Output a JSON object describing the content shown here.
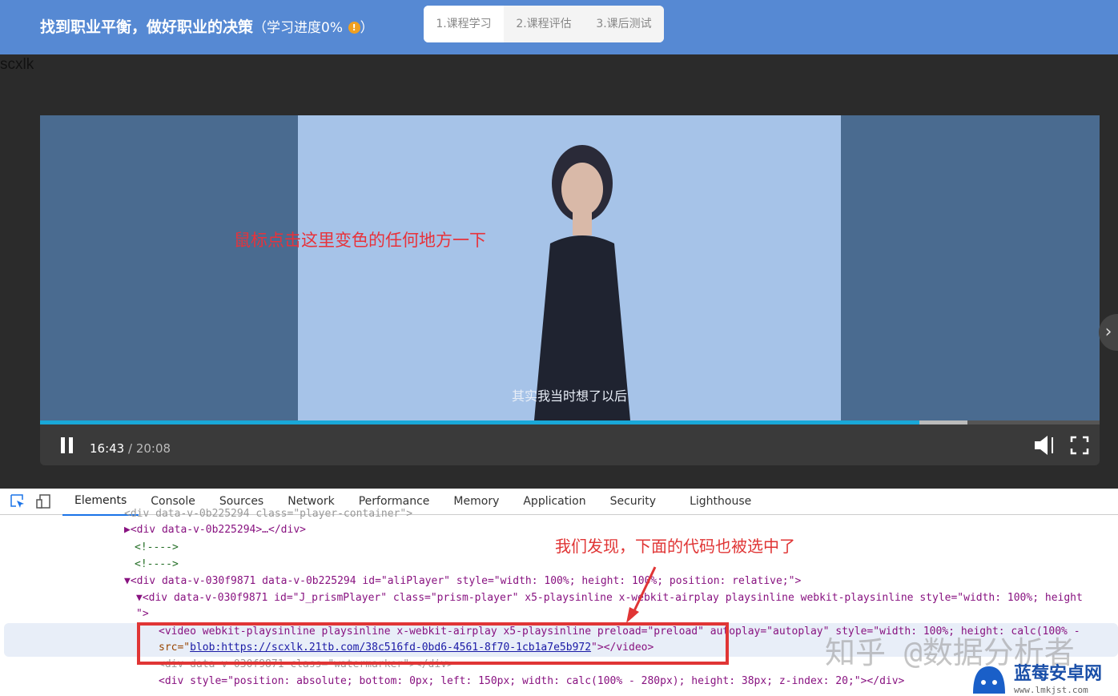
{
  "header": {
    "title": "找到职业平衡，做好职业的决策",
    "progress_note": "（学习进度0%",
    "info_icon": "!",
    "close_paren": "）",
    "steps": [
      {
        "label": "1.课程学习",
        "active": true
      },
      {
        "label": "2.课程评估"
      },
      {
        "label": "3.课后测试"
      }
    ]
  },
  "site_label": "scxlk",
  "player": {
    "hint": "鼠标点击这里变色的任何地方一下",
    "subtitle": "其实我当时想了以后",
    "current_time": "16:43",
    "duration": " / 20:08",
    "played_fraction": 0.83,
    "buffered_fraction": 0.875,
    "state": "playing"
  },
  "devtools": {
    "tabs": [
      "Elements",
      "Console",
      "Sources",
      "Network",
      "Performance",
      "Memory",
      "Application",
      "Security",
      "Lighthouse"
    ],
    "active_tab": "Elements",
    "annotation": "我们发现，下面的代码也被选中了",
    "lines": [
      "<div data-v-0b225294 class=\"player-container\">",
      "▶<div data-v-0b225294>…</div>",
      "<!---->",
      "<!---->",
      "▼<div data-v-030f9871 data-v-0b225294 id=\"aliPlayer\" style=\"width: 100%; height: 100%; position: relative;\">",
      "▼<div data-v-030f9871 id=\"J_prismPlayer\" class=\"prism-player\" x5-playsinline x-webkit-airplay playsinline webkit-playsinline style=\"width: 100%; height",
      "\">",
      "<video webkit-playsinline playsinline x-webkit-airplay x5-playsinline preload=\"preload\" autoplay=\"autoplay\" style=\"width: 100%; height: calc(100% -",
      "<div data-v-030f9871 class=\"watermarker\"></div>",
      "<div style=\"position: absolute; bottom: 0px; left: 150px; width: calc(100% - 280px); height: 38px; z-index: 20;\"></div>"
    ],
    "src_prefix": "src=\"",
    "src_link": "blob:https://scxlk.21tb.com/38c516fd-0bd6-4561-8f70-1cb1a7e5b972",
    "src_suffix": "\"></video>"
  },
  "watermark": "知乎 @数据分析者",
  "logo": {
    "name": "蓝莓安卓网",
    "url": "www.lmkjst.com"
  }
}
